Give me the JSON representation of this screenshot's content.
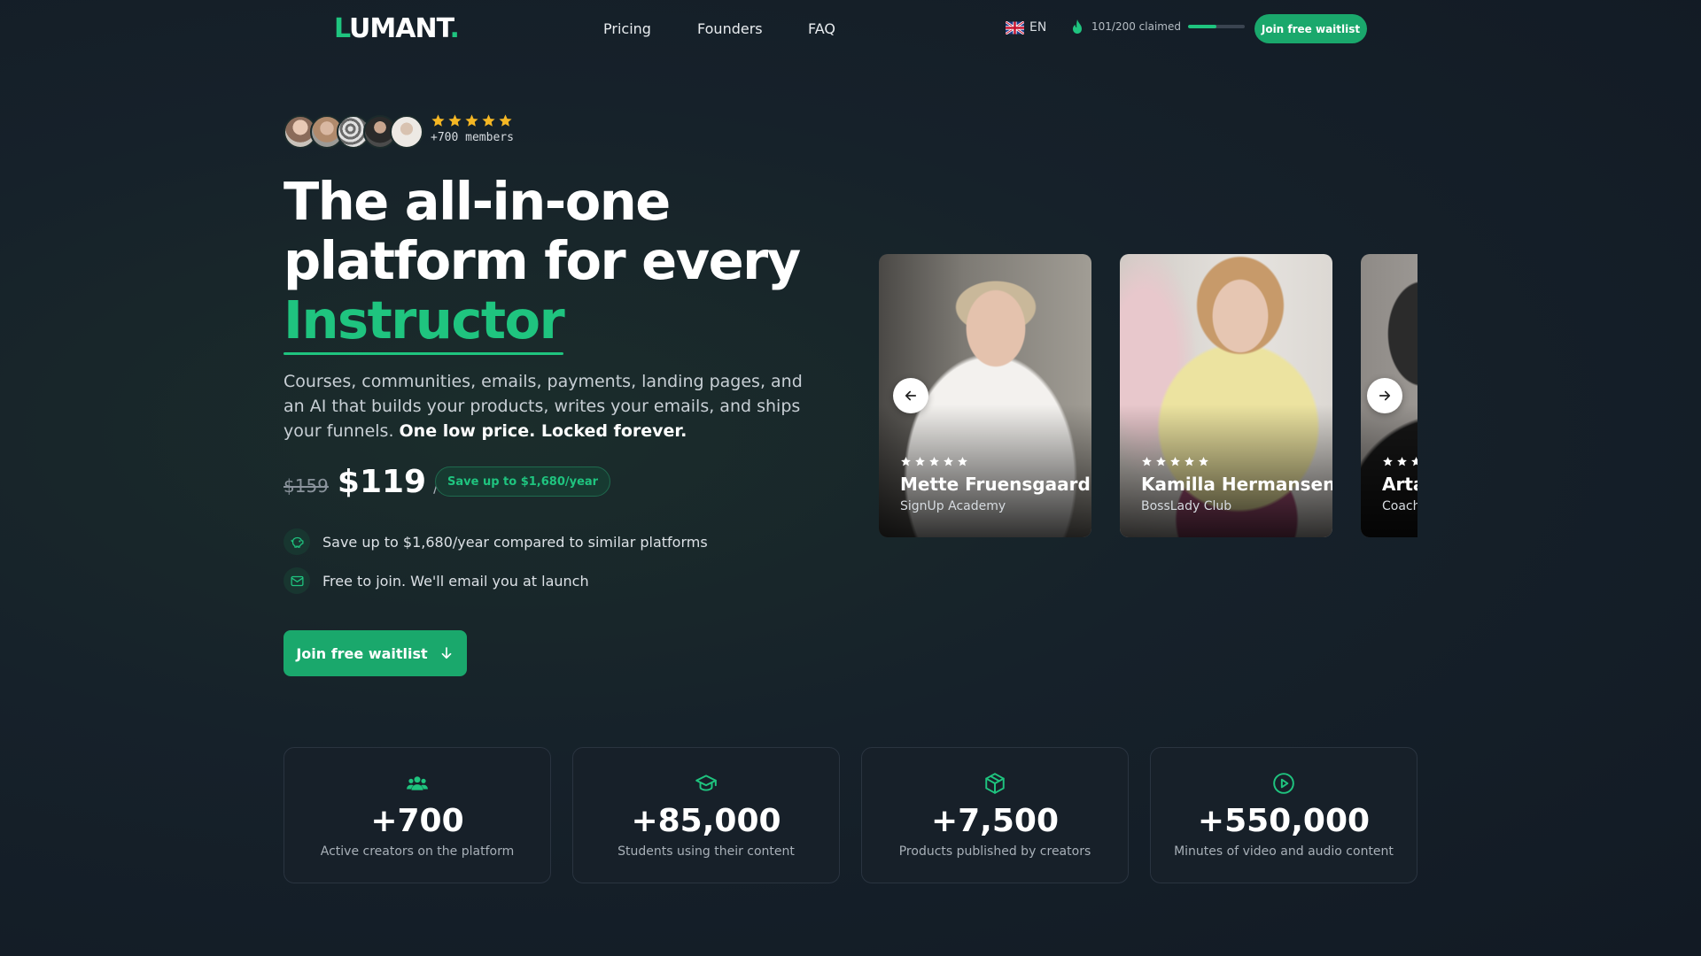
{
  "brand": {
    "logo_first": "L",
    "logo_rest": "UMANT",
    "logo_dot": "."
  },
  "nav": {
    "links": [
      "Pricing",
      "Founders",
      "FAQ"
    ],
    "language": "EN",
    "claimed_text": "101/200 claimed",
    "claimed_progress": 0.505,
    "cta": "Join free waitlist"
  },
  "hero": {
    "members": "+700 members",
    "rating_stars": 5,
    "headline_line1": "The all-in-one",
    "headline_line2": "platform for every",
    "headline_accent": "Instructor",
    "description": "Courses, communities, emails, payments, landing pages, and an AI that builds your products, writes your emails, and ships your funnels.",
    "description_bold": "One low price. Locked forever.",
    "old_price": "$159",
    "price": "$119",
    "per": "/mo",
    "save_badge": "Save up to $1,680/year",
    "features": [
      {
        "icon": "piggy-bank-icon",
        "text": "Save up to $1,680/year compared to similar platforms"
      },
      {
        "icon": "mail-icon",
        "text": "Free to join. We'll email you at launch"
      }
    ],
    "cta": "Join free waitlist"
  },
  "testimonials": [
    {
      "name": "Mette Fruensgaard",
      "org": "SignUp Academy",
      "stars": 5
    },
    {
      "name": "Kamilla Hermansen",
      "org": "BossLady Club",
      "stars": 5
    },
    {
      "name": "Arta",
      "org": "Coach",
      "stars": 5
    }
  ],
  "stats": [
    {
      "icon": "users-icon",
      "value": "+700",
      "label": "Active creators on the platform"
    },
    {
      "icon": "graduation-cap-icon",
      "value": "+85,000",
      "label": "Students using their content"
    },
    {
      "icon": "box-icon",
      "value": "+7,500",
      "label": "Products published by creators"
    },
    {
      "icon": "play-circle-icon",
      "value": "+550,000",
      "label": "Minutes of video and audio content"
    }
  ],
  "colors": {
    "accent": "#1fc47f",
    "button": "#1aa86c",
    "background": "#16212a",
    "card": "#172029"
  }
}
